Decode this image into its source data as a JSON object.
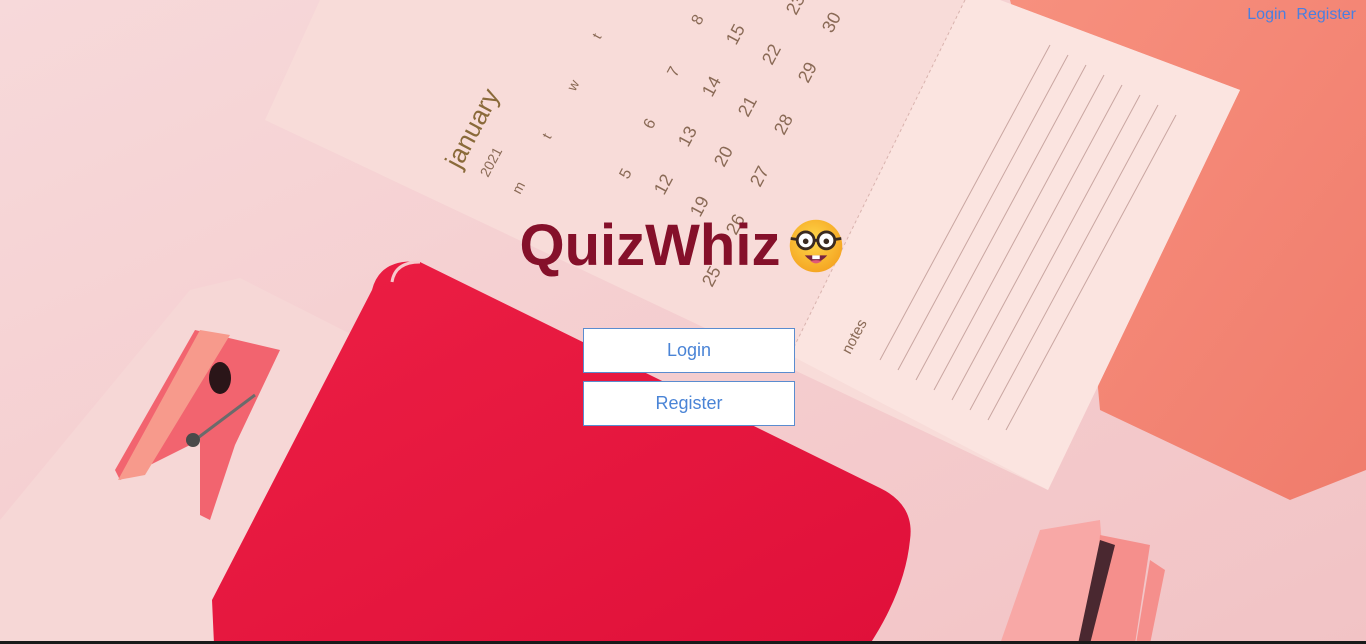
{
  "nav": {
    "login_label": "Login",
    "register_label": "Register"
  },
  "brand": {
    "title": "QuizWhiz",
    "emoji_icon": "nerd-face-icon"
  },
  "buttons": {
    "login_label": "Login",
    "register_label": "Register"
  },
  "background": {
    "calendar_month": "january",
    "calendar_year": "2021",
    "notes_label": "notes",
    "weekdays": [
      "m",
      "t",
      "w",
      "t"
    ],
    "dates": [
      "5",
      "6",
      "7",
      "8",
      "12",
      "13",
      "14",
      "15",
      "19",
      "20",
      "21",
      "22",
      "26",
      "27",
      "28",
      "29",
      "30",
      "25"
    ]
  },
  "colors": {
    "accent_link": "#4a7fe0",
    "brand_title": "#85102a",
    "button_border": "#5a8ccf"
  }
}
